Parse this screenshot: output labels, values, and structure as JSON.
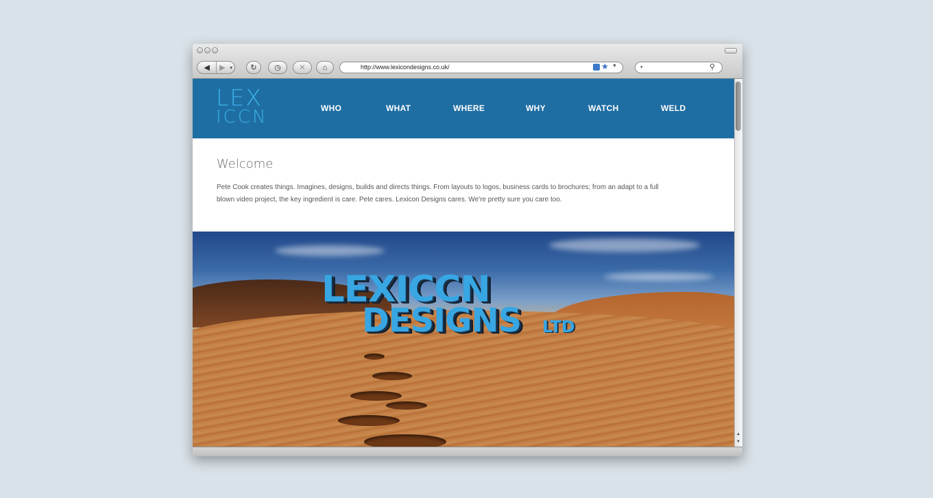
{
  "browser": {
    "url": "http://www.lexicondesigns.co.uk/",
    "icons": {
      "back": "back-arrow-icon",
      "forward": "forward-arrow-icon",
      "reload": "reload-icon",
      "history": "history-icon",
      "stop": "stop-icon",
      "home": "home-icon",
      "rss": "rss-icon",
      "bookmark": "star-icon",
      "search": "magnifier-icon"
    }
  },
  "site": {
    "logo": {
      "line1": "LEX",
      "line2": "ICCN"
    },
    "nav": [
      {
        "label": "WHO"
      },
      {
        "label": "WHAT"
      },
      {
        "label": "WHERE"
      },
      {
        "label": "WHY"
      },
      {
        "label": "WATCH"
      },
      {
        "label": "WELD"
      }
    ],
    "welcome": {
      "title": "Welcome",
      "body": "Pete Cook creates things. Imagines, designs, builds and directs things. From layouts to logos, business cards to brochures; from an adapt to a full blown video project, the key ingredient is care. Pete cares. Lexicon Designs cares. We're pretty sure you care too."
    },
    "hero": {
      "line1": "LEXICCN",
      "line2": "DESIGNS",
      "line3": "LTD"
    }
  },
  "colors": {
    "header_bg": "#1f6ea3",
    "logo": "#3ab0e6",
    "page_bg": "#d9e2e8"
  }
}
